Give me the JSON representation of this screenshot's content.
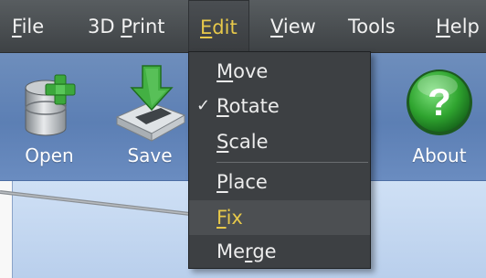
{
  "menubar": {
    "items": [
      {
        "pre": "",
        "u": "F",
        "post": "ile"
      },
      {
        "pre": "3D ",
        "u": "P",
        "post": "rint"
      },
      {
        "pre": "",
        "u": "E",
        "post": "dit"
      },
      {
        "pre": "",
        "u": "V",
        "post": "iew"
      },
      {
        "pre": "Tools",
        "u": "",
        "post": ""
      },
      {
        "pre": "",
        "u": "H",
        "post": "elp"
      }
    ],
    "active_index": 2
  },
  "toolbar": {
    "open_label": "Open",
    "save_label": "Save",
    "about_label": "About",
    "about_glyph": "?",
    "colors": {
      "accent": "#e6c84a",
      "toolbar": "#5c7fb4",
      "about_green": "#2fa42f"
    }
  },
  "edit_menu": {
    "items": [
      {
        "pre": "",
        "u": "M",
        "post": "ove",
        "checked": false
      },
      {
        "pre": "",
        "u": "R",
        "post": "otate",
        "checked": true
      },
      {
        "pre": "",
        "u": "S",
        "post": "cale",
        "checked": false
      },
      {
        "pre": "",
        "u": "P",
        "post": "lace",
        "checked": false
      },
      {
        "pre": "",
        "u": "F",
        "post": "ix",
        "checked": false
      },
      {
        "pre": "Me",
        "u": "r",
        "post": "ge",
        "checked": false
      }
    ],
    "check_glyph": "✓",
    "highlighted_index": 4
  }
}
